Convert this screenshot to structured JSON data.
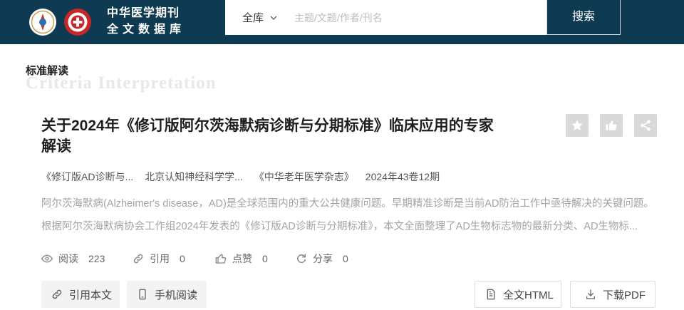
{
  "colors": {
    "header_bg": "#0e3a52",
    "action_button_bg": "#d9d9d9",
    "abstract_text": "#a3a3a3"
  },
  "header": {
    "title_line1": "中华医学期刊",
    "title_line2": "全文数据库",
    "search": {
      "scope": "全库",
      "placeholder": "主题/文题/作者/刊名",
      "value": "",
      "button": "搜索"
    }
  },
  "section": {
    "title": "标准解读",
    "subtitle_en": "Criteria Interpretation"
  },
  "article": {
    "title": "关于2024年《修订版阿尔茨海默病诊断与分期标准》临床应用的专家解读",
    "actions": [
      {
        "icon": "star-icon"
      },
      {
        "icon": "thumbs-up-icon"
      },
      {
        "icon": "share-icon"
      }
    ],
    "meta": [
      "《修订版AD诊断与...",
      "北京认知神经科学学...",
      "《中华老年医学杂志》",
      "2024年43卷12期"
    ],
    "abstract_lines": [
      "阿尔茨海默病(Alzheimer's disease，AD)是全球范围内的重大公共健康问题。早期精准诊断是当前AD防治工作中亟待解决的关键问题。",
      "根据阿尔茨海默病协会工作组2024年发表的《修订版AD诊断与分期标准》，本文全面整理了AD生物标志物的最新分类、AD生物标..."
    ],
    "stats": [
      {
        "icon": "eye-icon",
        "label": "阅读",
        "count": "223"
      },
      {
        "icon": "link-icon",
        "label": "引用",
        "count": "0"
      },
      {
        "icon": "thumbs-up-icon",
        "label": "点赞",
        "count": "0"
      },
      {
        "icon": "share-icon",
        "label": "分享",
        "count": "0"
      }
    ],
    "buttons": [
      {
        "icon": "link-icon",
        "label": "引用本文"
      },
      {
        "icon": "phone-icon",
        "label": "手机阅读"
      },
      {
        "icon": "document-icon",
        "label": "全文HTML"
      },
      {
        "icon": "download-icon",
        "label": "下载PDF"
      }
    ]
  }
}
